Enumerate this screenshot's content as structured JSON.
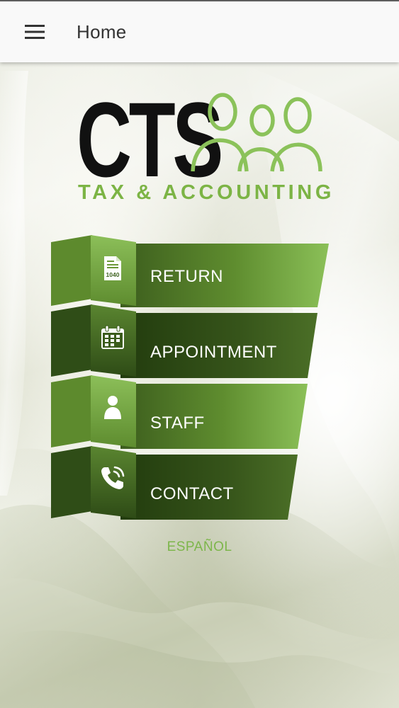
{
  "app_bar": {
    "title": "Home",
    "menu_icon": "hamburger-menu-icon"
  },
  "logo": {
    "brand": "CTS",
    "tagline": "TAX & ACCOUNTING",
    "icon": "three-people-icon"
  },
  "menu": [
    {
      "label": "RETURN",
      "icon": "tax-form-1040-icon",
      "icon_text": "1040"
    },
    {
      "label": "APPOINTMENT",
      "icon": "calendar-icon"
    },
    {
      "label": "STAFF",
      "icon": "person-icon"
    },
    {
      "label": "CONTACT",
      "icon": "phone-icon"
    }
  ],
  "language_link": "ESPAÑOL",
  "colors": {
    "brand_green": "#7cb445",
    "dark_green": "#2f4a17",
    "light_green": "#8bc058",
    "app_bar_bg": "#f9f9f9"
  }
}
